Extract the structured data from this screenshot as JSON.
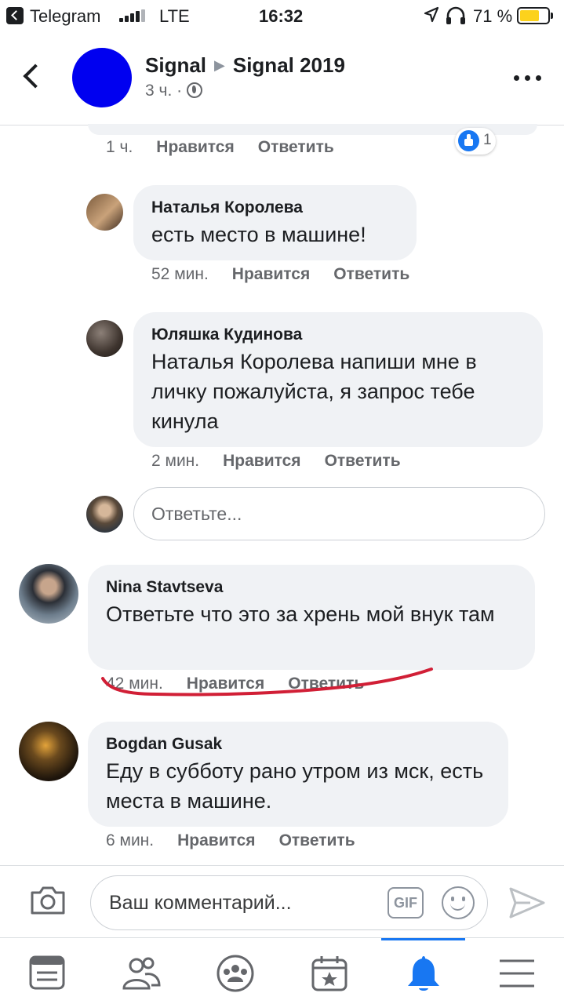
{
  "status_bar": {
    "back_app": "Telegram",
    "network": "LTE",
    "time": "16:32",
    "battery": "71 %",
    "battery_level": 0.71
  },
  "header": {
    "author": "Signal",
    "target": "Signal 2019",
    "arrow": "▶",
    "meta": "3 ч. ·"
  },
  "top_comment": {
    "time": "1 ч.",
    "like": "Нравится",
    "reply": "Ответить",
    "like_count": "1"
  },
  "replies": [
    {
      "author": "Наталья Королева",
      "text": "есть место в машине!",
      "time": "52 мин.",
      "like": "Нравится",
      "reply": "Ответить"
    },
    {
      "author": "Юляшка Кудинова",
      "text": "Наталья Королева напиши мне в личку пожалуйста, я запрос тебе кинула",
      "time": "2 мин.",
      "like": "Нравится",
      "reply": "Ответить"
    }
  ],
  "reply_input": {
    "placeholder": "Ответьте..."
  },
  "comments": [
    {
      "author": "Nina Stavtseva",
      "text": "Ответьте что это за хрень  мой внук там",
      "time": "42 мин.",
      "like": "Нравится",
      "reply": "Ответить"
    },
    {
      "author": "Bogdan Gusak",
      "text": "Еду в субботу рано утром из мск, есть места в машине.",
      "time": "6 мин.",
      "like": "Нравится",
      "reply": "Ответить"
    }
  ],
  "composer": {
    "placeholder": "Ваш комментарий...",
    "gif_label": "GIF"
  },
  "tabs": [
    "news-feed",
    "friends",
    "groups",
    "marketplace",
    "notifications",
    "menu"
  ],
  "colors": {
    "accent": "#1877f2",
    "bubble": "#f0f2f5",
    "group_avatar": "#0000f0",
    "annotation_red": "#d11f36",
    "battery": "#fcd21c"
  }
}
